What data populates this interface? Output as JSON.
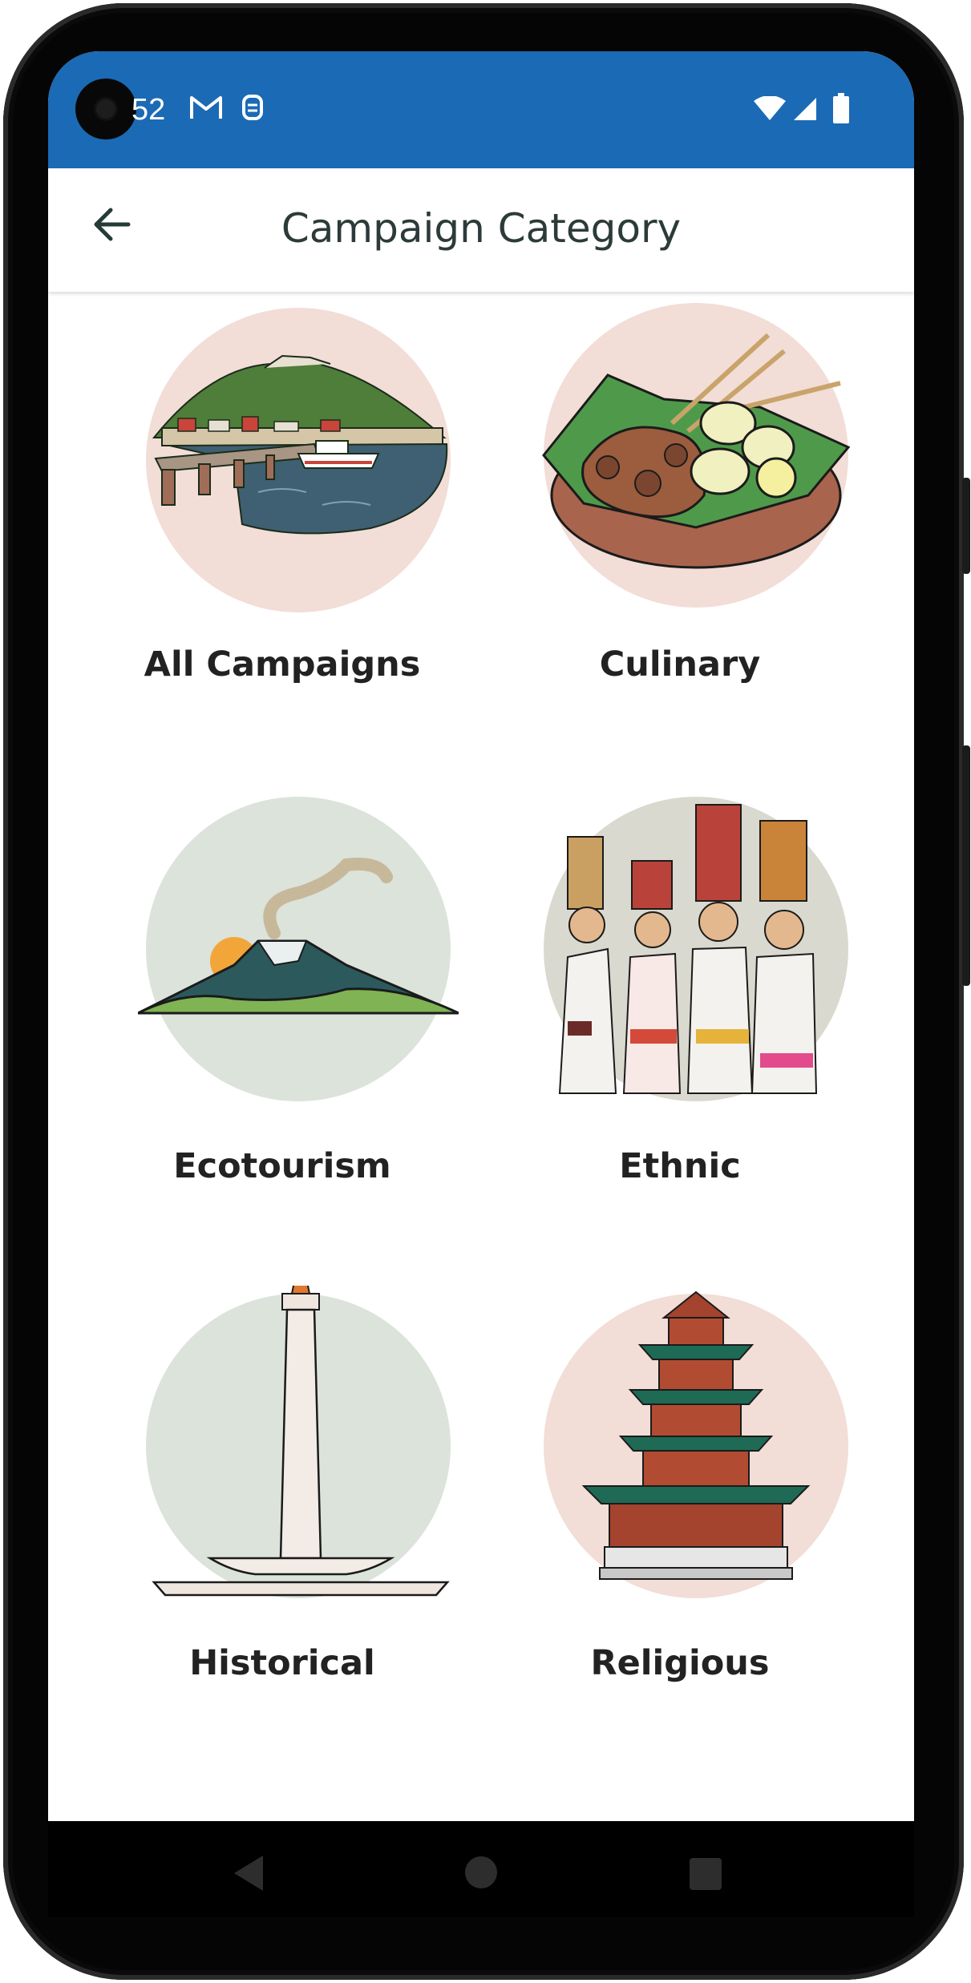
{
  "status_bar": {
    "time": "52",
    "icons": [
      "gmail-icon",
      "security-icon",
      "wifi-icon",
      "cellular-icon",
      "battery-icon"
    ],
    "color": "#1b6ab5"
  },
  "app_bar": {
    "title": "Campaign Category",
    "back_icon": "arrow-back-icon"
  },
  "categories": [
    {
      "label": "All Campaigns",
      "illustration": "harbor-island",
      "bg": "#f2ddd7"
    },
    {
      "label": "Culinary",
      "illustration": "satay-plate",
      "bg": "#f2ddd7"
    },
    {
      "label": "Ecotourism",
      "illustration": "volcano",
      "bg": "#dbe3db"
    },
    {
      "label": "Ethnic",
      "illustration": "balinese-women",
      "bg": "#d9d9cf"
    },
    {
      "label": "Historical",
      "illustration": "monument-tower",
      "bg": "#dbe3db"
    },
    {
      "label": "Religious",
      "illustration": "pagoda",
      "bg": "#f2ddd7"
    }
  ],
  "nav_bar": {
    "back": "nav-back-icon",
    "home": "nav-home-icon",
    "recents": "nav-recents-icon"
  }
}
